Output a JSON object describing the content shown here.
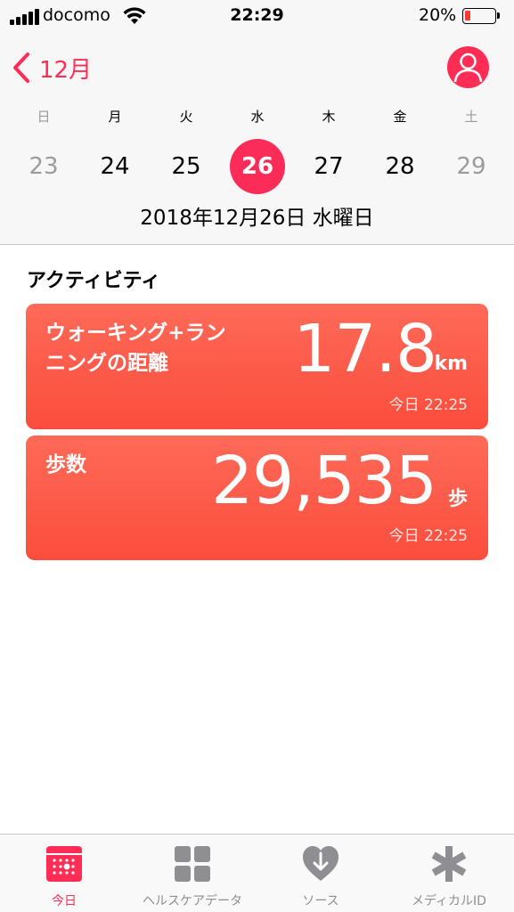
{
  "status_bar": {
    "carrier": "docomo",
    "time": "22:29",
    "battery_percent": "20%",
    "battery_level": 0.2
  },
  "nav": {
    "back_label": "12月",
    "back_icon": "chevron-left-icon",
    "profile_icon": "person-icon"
  },
  "week": {
    "weekdays": [
      "日",
      "月",
      "火",
      "水",
      "木",
      "金",
      "土"
    ],
    "days": [
      "23",
      "24",
      "25",
      "26",
      "27",
      "28",
      "29"
    ],
    "selected_index": 3,
    "full_date": "2018年12月26日 水曜日"
  },
  "activity": {
    "section_title": "アクティビティ",
    "cards": [
      {
        "title": "ウォーキング+ラン\nニングの距離",
        "value": "17.8",
        "unit": "km",
        "time": "今日 22:25"
      },
      {
        "title": "歩数",
        "value": "29,535",
        "unit": "歩",
        "time": "今日 22:25"
      }
    ]
  },
  "tabbar": {
    "tabs": [
      {
        "label": "今日",
        "icon": "calendar-today-icon",
        "active": true
      },
      {
        "label": "ヘルスケアデータ",
        "icon": "grid-icon",
        "active": false
      },
      {
        "label": "ソース",
        "icon": "heart-download-icon",
        "active": false
      },
      {
        "label": "メディカルID",
        "icon": "asterisk-icon",
        "active": false
      }
    ]
  },
  "colors": {
    "accent": "#ff2d55",
    "card_top": "#fe6a58",
    "card_bottom": "#fb4d3d",
    "inactive": "#8e8e93"
  }
}
